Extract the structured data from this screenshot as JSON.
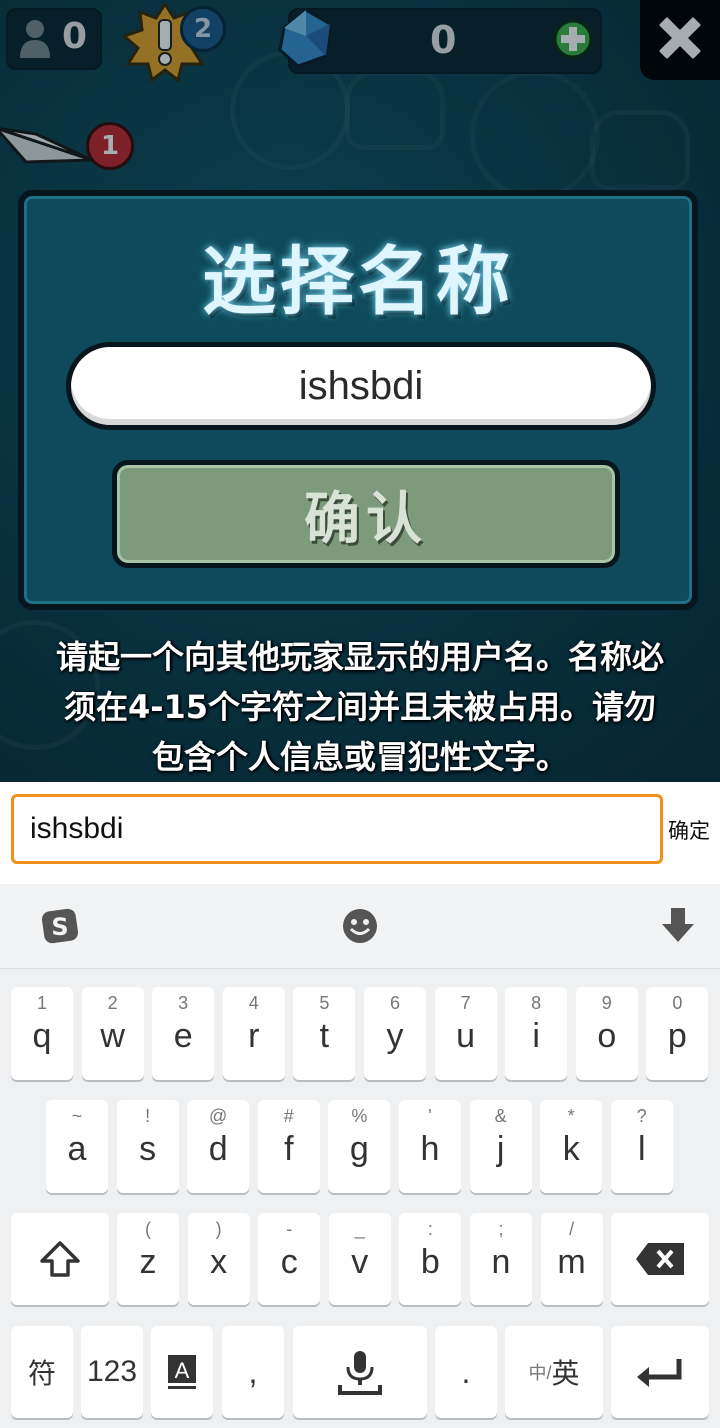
{
  "hud": {
    "players_count": "0",
    "alert_badge": "2",
    "gems_count": "0",
    "mail_badge": "1"
  },
  "modal": {
    "title": "选择名称",
    "name_value": "ishsbdi",
    "confirm_label": "确认"
  },
  "hint_text": "请起一个向其他玩家显示的用户名。名称必须在4-15个字符之间并且未被占用。请勿包含个人信息或冒犯性文字。",
  "input_bar": {
    "value": "ishsbdi",
    "ok_label": "确定"
  },
  "keyboard": {
    "row1": [
      {
        "hint": "1",
        "key": "q"
      },
      {
        "hint": "2",
        "key": "w"
      },
      {
        "hint": "3",
        "key": "e"
      },
      {
        "hint": "4",
        "key": "r"
      },
      {
        "hint": "5",
        "key": "t"
      },
      {
        "hint": "6",
        "key": "y"
      },
      {
        "hint": "7",
        "key": "u"
      },
      {
        "hint": "8",
        "key": "i"
      },
      {
        "hint": "9",
        "key": "o"
      },
      {
        "hint": "0",
        "key": "p"
      }
    ],
    "row2": [
      {
        "hint": "~",
        "key": "a"
      },
      {
        "hint": "!",
        "key": "s"
      },
      {
        "hint": "@",
        "key": "d"
      },
      {
        "hint": "#",
        "key": "f"
      },
      {
        "hint": "%",
        "key": "g"
      },
      {
        "hint": "'",
        "key": "h"
      },
      {
        "hint": "&",
        "key": "j"
      },
      {
        "hint": "*",
        "key": "k"
      },
      {
        "hint": "?",
        "key": "l"
      }
    ],
    "row3": [
      {
        "hint": "(",
        "key": "z"
      },
      {
        "hint": ")",
        "key": "x"
      },
      {
        "hint": "-",
        "key": "c"
      },
      {
        "hint": "_",
        "key": "v"
      },
      {
        "hint": ":",
        "key": "b"
      },
      {
        "hint": ";",
        "key": "n"
      },
      {
        "hint": "/",
        "key": "m"
      }
    ],
    "symbols_label": "符",
    "numbers_label": "123",
    "comma_label": ",",
    "period_label": ".",
    "lang_small": "中/",
    "lang_big": "英"
  }
}
